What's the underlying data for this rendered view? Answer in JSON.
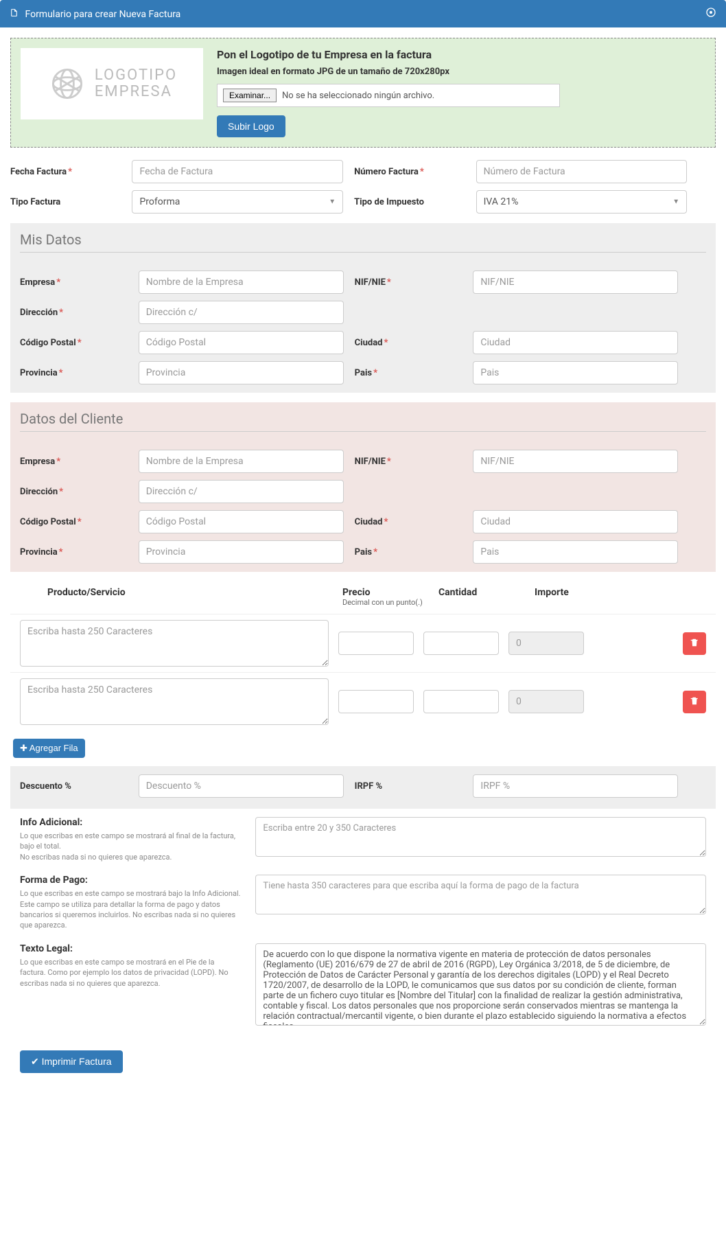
{
  "header": {
    "title": "Formulario para crear Nueva Factura"
  },
  "logo": {
    "placeholder_line1": "LOGOTIPO",
    "placeholder_line2": "EMPRESA",
    "title": "Pon el Logotipo de tu Empresa en la factura",
    "subtitle": "Imagen ideal en formato JPG de un tamaño de 720x280px",
    "browse": "Examinar...",
    "no_file": "No se ha seleccionado ningún archivo.",
    "upload_btn": "Subir Logo"
  },
  "top_fields": {
    "fecha_label": "Fecha Factura",
    "fecha_ph": "Fecha de Factura",
    "numero_label": "Número Factura",
    "numero_ph": "Número de Factura",
    "tipo_label": "Tipo Factura",
    "tipo_val": "Proforma",
    "impuesto_label": "Tipo de Impuesto",
    "impuesto_val": "IVA 21%"
  },
  "mis_datos": {
    "title": "Mis Datos",
    "empresa_l": "Empresa",
    "empresa_ph": "Nombre de la Empresa",
    "nif_l": "NIF/NIE",
    "nif_ph": "NIF/NIE",
    "dir_l": "Dirección",
    "dir_ph": "Dirección c/",
    "cp_l": "Código Postal",
    "cp_ph": "Código Postal",
    "ciudad_l": "Ciudad",
    "ciudad_ph": "Ciudad",
    "prov_l": "Provincia",
    "prov_ph": "Provincia",
    "pais_l": "Pais",
    "pais_ph": "Pais"
  },
  "cliente": {
    "title": "Datos del Cliente",
    "empresa_l": "Empresa",
    "empresa_ph": "Nombre de la Empresa",
    "nif_l": "NIF/NIE",
    "nif_ph": "NIF/NIE",
    "dir_l": "Dirección",
    "dir_ph": "Dirección c/",
    "cp_l": "Código Postal",
    "cp_ph": "Código Postal",
    "ciudad_l": "Ciudad",
    "ciudad_ph": "Ciudad",
    "prov_l": "Provincia",
    "prov_ph": "Provincia",
    "pais_l": "Pais",
    "pais_ph": "Pais"
  },
  "products": {
    "h1": "Producto/Servicio",
    "h2": "Precio",
    "h2s": "Decimal con un punto(.)",
    "h3": "Cantidad",
    "h4": "Importe",
    "desc_ph": "Escriba hasta 250 Caracteres",
    "importe_val": "0",
    "add_btn": "Agregar Fila"
  },
  "calc": {
    "desc_l": "Descuento %",
    "desc_ph": "Descuento %",
    "irpf_l": "IRPF %",
    "irpf_ph": "IRPF %"
  },
  "extras": {
    "info_t": "Info Adicional:",
    "info_h": "Lo que escribas en este campo se mostrará al final de la factura, bajo el total.\nNo escribas nada si no quieres que aparezca.",
    "info_ph": "Escriba entre 20 y 350 Caracteres",
    "pago_t": "Forma de Pago:",
    "pago_h": "Lo que escribas en este campo se mostrará bajo la Info Adicional. Este campo se utiliza para detallar la forma de pago y datos bancarios si queremos incluirlos. No escribas nada si no quieres que aparezca.",
    "pago_ph": "Tiene hasta 350 caracteres para que escriba aquí la forma de pago de la factura",
    "legal_t": "Texto Legal:",
    "legal_h": "Lo que escribas en este campo se mostrará en el Pie de la factura. Como por ejemplo los datos de privacidad (LOPD). No escribas nada si no quieres que aparezca.",
    "legal_val": "De acuerdo con lo que dispone la normativa vigente en materia de protección de datos personales (Reglamento (UE) 2016/679 de 27 de abril de 2016 (RGPD), Ley Orgánica 3/2018, de 5 de diciembre, de Protección de Datos de Carácter Personal y garantía de los derechos digitales (LOPD) y el Real Decreto 1720/2007, de desarrollo de la LOPD, le comunicamos que sus datos por su condición de cliente, forman parte de un fichero cuyo titular es [Nombre del Titular] con la finalidad de realizar la gestión administrativa, contable y fiscal. Los datos personales que nos proporcione serán conservados mientras se mantenga la relación contractual/mercantil vigente, o bien durante el plazo establecido siguiendo la normativa a efectos fiscales.\nAsimismo le informamos que podrá en cualquier momento ejercitar sus derechos de acceso, supresión,"
  },
  "print_btn": "Imprimir Factura"
}
